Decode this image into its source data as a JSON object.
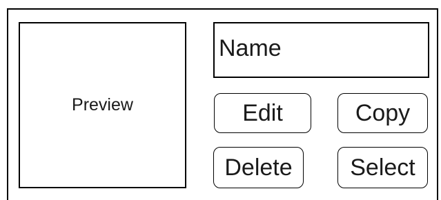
{
  "preview": {
    "label": "Preview"
  },
  "name_field": {
    "value": "Name"
  },
  "buttons": {
    "edit": "Edit",
    "copy": "Copy",
    "delete": "Delete",
    "select": "Select"
  }
}
